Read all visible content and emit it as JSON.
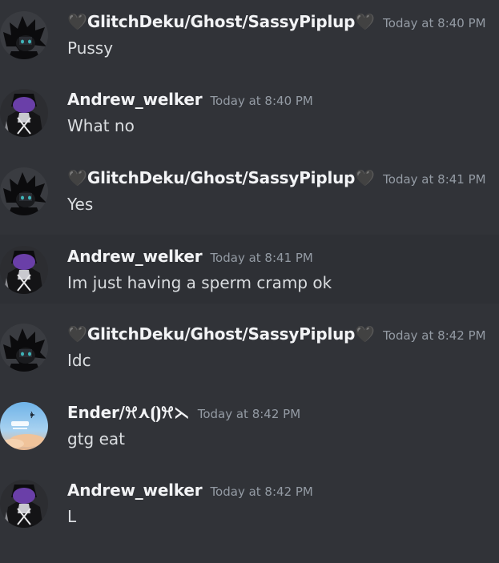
{
  "messages": [
    {
      "name_pre": "🖤",
      "name": "GlitchDeku/Ghost/SassyPiplup",
      "name_post": "🖤",
      "avatar": "ghost",
      "timestamp": "Today at 8:40 PM",
      "text": "Pussy"
    },
    {
      "name_pre": "",
      "name": "Andrew_welker",
      "name_post": "",
      "avatar": "andrew",
      "timestamp": "Today at 8:40 PM",
      "text": "What no"
    },
    {
      "name_pre": "🖤",
      "name": "GlitchDeku/Ghost/SassyPiplup",
      "name_post": "🖤",
      "avatar": "ghost",
      "timestamp": "Today at 8:41 PM",
      "text": "Yes"
    },
    {
      "name_pre": "",
      "name": "Andrew_welker",
      "name_post": "",
      "avatar": "andrew",
      "timestamp": "Today at 8:41 PM",
      "text": "Im just having a sperm cramp ok"
    },
    {
      "name_pre": "🖤",
      "name": "GlitchDeku/Ghost/SassyPiplup",
      "name_post": "🖤",
      "avatar": "ghost",
      "timestamp": "Today at 8:42 PM",
      "text": "Idc"
    },
    {
      "name_pre": "",
      "name": "Ender/ꕮ⋏⦗⦘ꕮ⋋",
      "name_post": "",
      "avatar": "ender",
      "timestamp": "Today at 8:42 PM",
      "text": "gtg eat"
    },
    {
      "name_pre": "",
      "name": "Andrew_welker",
      "name_post": "",
      "avatar": "andrew",
      "timestamp": "Today at 8:42 PM",
      "text": "L"
    }
  ],
  "colors": {
    "background": "#313338",
    "hover_background": "#2e3035",
    "username": "#f2f3f5",
    "message_text": "#dbdee1",
    "timestamp": "#949ba4"
  }
}
